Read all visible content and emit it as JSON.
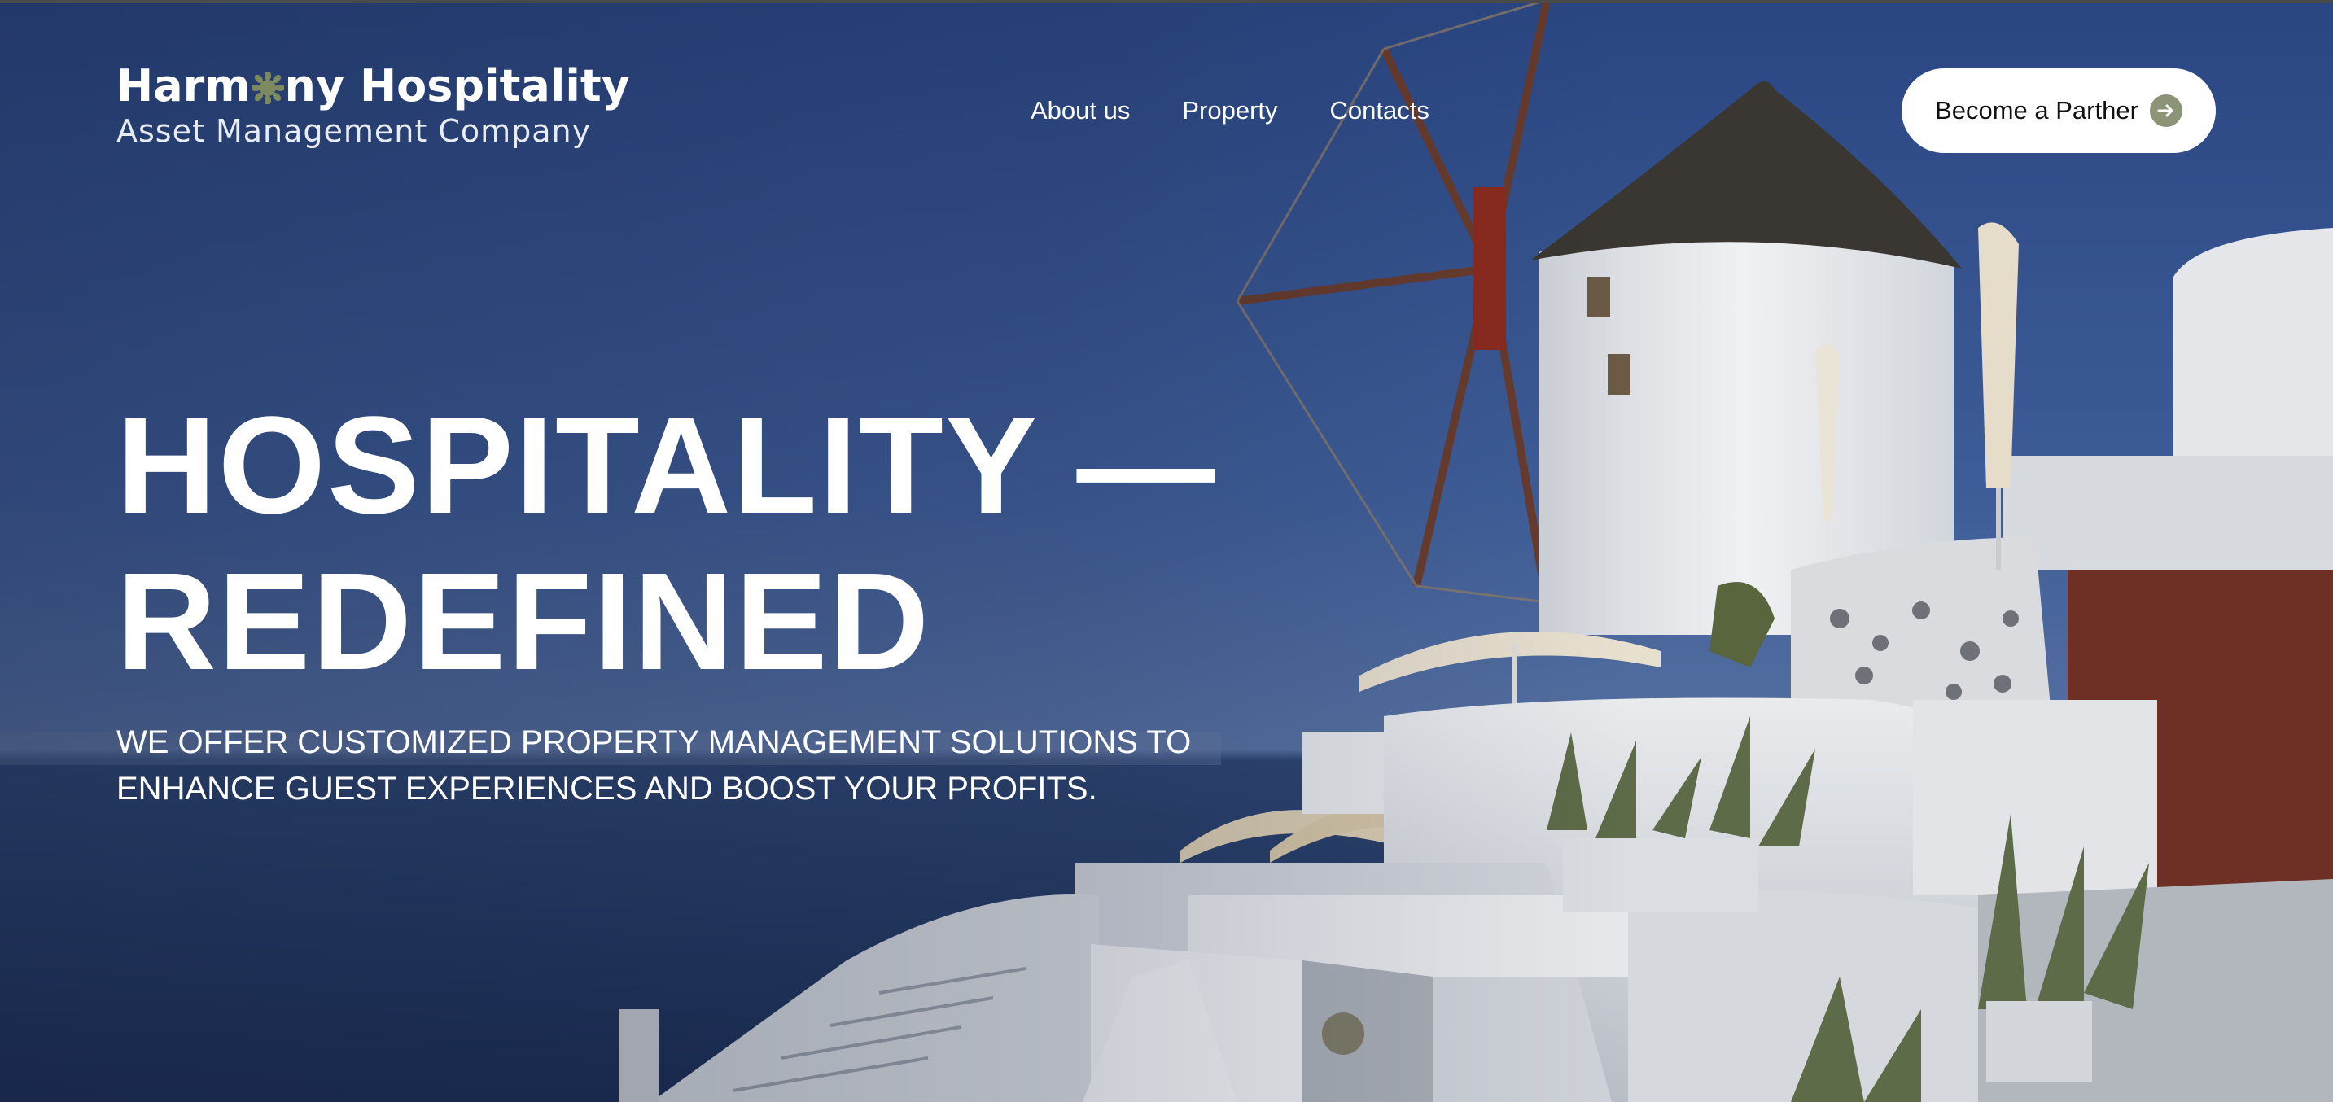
{
  "brand": {
    "name_part1": "Harm",
    "name_part2": "ny Hospitality",
    "subtitle": "Asset Management Company",
    "logo_mark_icon": "sun-leaf-icon",
    "accent_color": "#7d8a5f"
  },
  "nav": {
    "items": [
      {
        "label": "About us"
      },
      {
        "label": "Property"
      },
      {
        "label": "Contacts"
      }
    ]
  },
  "cta": {
    "label": "Become a Parther",
    "icon": "arrow-right-circle-icon",
    "icon_color": "#8c9478"
  },
  "hero": {
    "headline_line1": "HOSPITALITY —",
    "headline_line2": "REDEFINED",
    "subtext_line1": "WE OFFER CUSTOMIZED PROPERTY MANAGEMENT SOLUTIONS TO",
    "subtext_line2": "ENHANCE GUEST EXPERIENCES AND BOOST YOUR PROFITS.",
    "background_image": "santorini-windmill-photo"
  },
  "colors": {
    "sky_top": "#2b4780",
    "sea": "#1d3157",
    "text": "#ffffff",
    "button_bg": "#ffffff",
    "button_text": "#111111"
  }
}
